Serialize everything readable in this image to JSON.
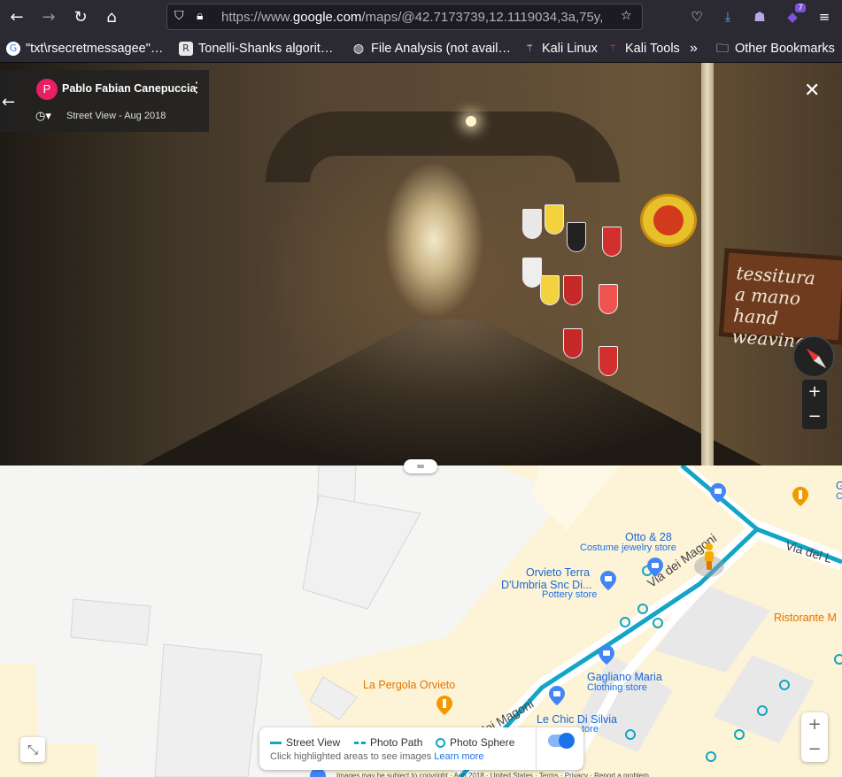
{
  "browser": {
    "url_prefix": "https://www.",
    "url_domain": "google.com",
    "url_rest": "/maps/@42.7173739,12.1119034,3a,75y,",
    "extensions_badge": "7",
    "bookmarks": [
      {
        "label": "\"txt\\rsecretmessagee\"…",
        "icon": "google-icon"
      },
      {
        "label": "Tonelli-Shanks algorit…",
        "icon": "page-icon"
      },
      {
        "label": "File Analysis (not avail…",
        "icon": "globe-icon"
      },
      {
        "label": "Kali Linux",
        "icon": "kali-icon"
      },
      {
        "label": "Kali Tools",
        "icon": "kali-tools-icon"
      }
    ],
    "overflow_label": "»",
    "other_bookmarks": "Other Bookmarks"
  },
  "street_view": {
    "avatar_letter": "P",
    "author": "Pablo Fabian Canepuccia",
    "date": "Street View - Aug 2018",
    "sign_text": "tessitura\na mano\nhand\nweaving"
  },
  "map": {
    "places": {
      "otto": "Otto & 28",
      "otto_type": "Costume jewelry store",
      "orvieto_terra_1": "Orvieto Terra",
      "orvieto_terra_2": "D'Umbria Snc Di...",
      "orvieto_terra_type": "Pottery store",
      "gagliano": "Gagliano Maria",
      "gagliano_type": "Clothing store",
      "lechic": "Le Chic Di Silvia",
      "lechic_type": "…tore",
      "pergola": "La Pergola Orvieto",
      "ristorante": "Ristorante M",
      "g_edge": "G",
      "c_edge": "C"
    },
    "roads": {
      "magoni_1": "Via dei Magoni",
      "magoni_2": "dei Magoni",
      "via_del": "Via del L"
    },
    "legend": {
      "street_view": "Street View",
      "photo_path": "Photo Path",
      "photo_sphere": "Photo Sphere",
      "hint": "Click highlighted areas to see images",
      "learn_more": "Learn more"
    },
    "footer": "Images may be subject to copyright · Aug 2018 · United States · Terms · Privacy · Report a problem"
  },
  "colors": {
    "accent": "#1a73e8",
    "route": "#12a5c6",
    "building": "#fdf3d6"
  }
}
